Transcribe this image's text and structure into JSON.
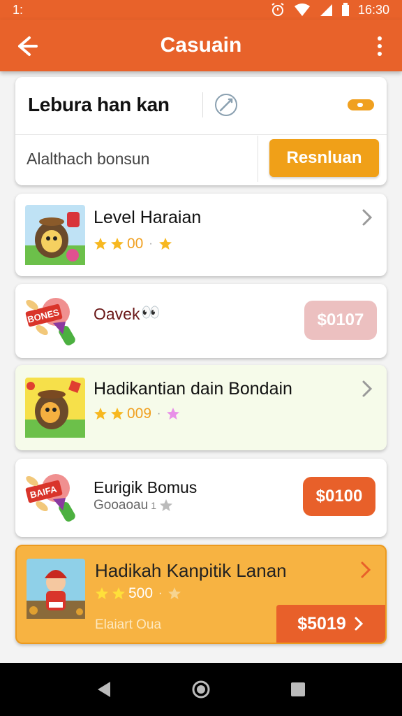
{
  "status_bar": {
    "time_left": "1:",
    "time_right": "16:30"
  },
  "app_bar": {
    "title": "Casuain",
    "back_icon": "back-arrow-icon",
    "menu_icon": "more-vert-icon"
  },
  "search": {
    "title": "Lebura han kan",
    "placeholder": "Alalthach bonsun",
    "button": "Resnluan"
  },
  "items": [
    {
      "title": "Level Haraian",
      "rating_text": "00",
      "price": null
    },
    {
      "title": "Oavek",
      "emoji": "👀",
      "price": "$0107"
    },
    {
      "title": "Hadikantian dain Bondain",
      "rating_text": "009",
      "price": null
    },
    {
      "title": "Eurigik Bomus",
      "subtitle": "Gooaoau",
      "subtitle_suffix": "1",
      "price": "$0100"
    },
    {
      "title": "Hadikah Kanpitik Lanan",
      "rating_text": "500",
      "subtitle": "Elaiart Oua",
      "price": "$5019"
    }
  ],
  "banner_texts": [
    "BONES",
    "BAIFA"
  ],
  "colors": {
    "primary": "#e8622a",
    "accent": "#f0a018",
    "price_light": "#ecc0c0",
    "price_strong": "#e8602a"
  }
}
